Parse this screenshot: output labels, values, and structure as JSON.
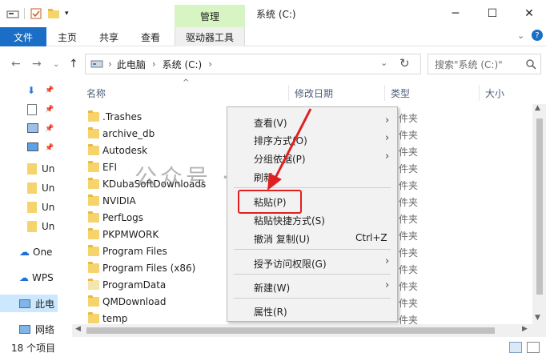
{
  "window": {
    "manage_tab": "管理",
    "title": "系统 (C:)",
    "minimize": "─",
    "maximize": "☐",
    "close": "✕"
  },
  "ribbon": {
    "tabs": [
      "文件",
      "主页",
      "共享",
      "查看",
      "驱动器工具"
    ]
  },
  "address": {
    "path": [
      "此电脑",
      "系统 (C:)"
    ],
    "search_placeholder": "搜索\"系统 (C:)\""
  },
  "nav_pane": {
    "items": [
      "Un",
      "Un",
      "Un",
      "Un",
      "One",
      "WPS",
      "此电",
      "网络"
    ]
  },
  "columns": {
    "name": "名称",
    "modified": "修改日期",
    "type": "类型",
    "size": "大小"
  },
  "files": [
    {
      "name": ".Trashes",
      "type": "件夹"
    },
    {
      "name": "archive_db",
      "type": "件夹"
    },
    {
      "name": "Autodesk",
      "type": "件夹"
    },
    {
      "name": "EFI",
      "type": "件夹"
    },
    {
      "name": "KDubaSoftDownloads",
      "type": "件夹"
    },
    {
      "name": "NVIDIA",
      "type": "件夹"
    },
    {
      "name": "PerfLogs",
      "type": "件夹"
    },
    {
      "name": "PKPMWORK",
      "type": "件夹"
    },
    {
      "name": "Program Files",
      "type": "件夹"
    },
    {
      "name": "Program Files (x86)",
      "type": "件夹"
    },
    {
      "name": "ProgramData",
      "type": "件夹"
    },
    {
      "name": "QMDownload",
      "type": "件夹"
    },
    {
      "name": "temp",
      "type": "件夹"
    }
  ],
  "status": {
    "count": "18 个项目"
  },
  "context_menu": {
    "view": "查看(V)",
    "sort": "排序方式(O)",
    "group": "分组依据(P)",
    "refresh": "刷新",
    "paste": "粘贴(P)",
    "paste_shortcut": "粘贴快捷方式(S)",
    "undo": "撤消 复制(U)",
    "undo_shortcut": "Ctrl+Z",
    "grant_access": "授予访问权限(G)",
    "new": "新建(W)",
    "properties": "属性(R)"
  },
  "watermark": "公众号 · 开源神器",
  "colors": {
    "file_tab": "#1a6ec5",
    "manage_tab": "#d6f5c3",
    "selection": "#cce8ff",
    "highlight_box": "#e02020"
  }
}
